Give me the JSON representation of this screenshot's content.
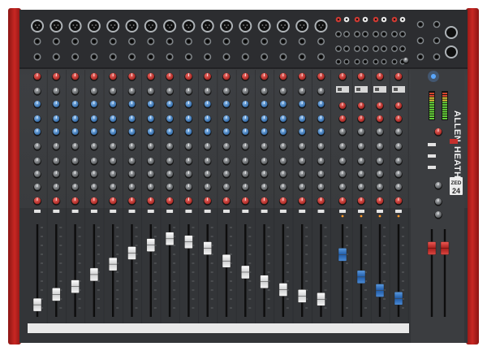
{
  "brand": {
    "left": "ALLEN",
    "right": "HEATH",
    "model": "ZED",
    "channels_label": "24"
  },
  "colors": {
    "side_panel": "#b4201e",
    "surface": "#3c3e41",
    "surface_dark": "#2a2b2d",
    "knob_red": "#c6302c",
    "knob_blue": "#3f7fc3",
    "knob_grey": "#6a6d70",
    "fader_white": "#e6e6e6",
    "fader_blue": "#2f6fc0",
    "fader_red": "#c22a27",
    "meter_green": "#6adf3a",
    "meter_yellow": "#e8d23a",
    "power_led": "#5aa8ff"
  },
  "layout_desc": {
    "mono_channels": 16,
    "stereo_channels": 4,
    "master_faders": 2
  },
  "fader_levels": [
    0.07,
    0.2,
    0.3,
    0.45,
    0.58,
    0.72,
    0.82,
    0.9,
    0.86,
    0.78,
    0.62,
    0.48,
    0.36,
    0.26,
    0.18,
    0.14,
    0.7,
    0.42,
    0.25,
    0.15
  ],
  "master_fader_levels": [
    0.78,
    0.78
  ]
}
